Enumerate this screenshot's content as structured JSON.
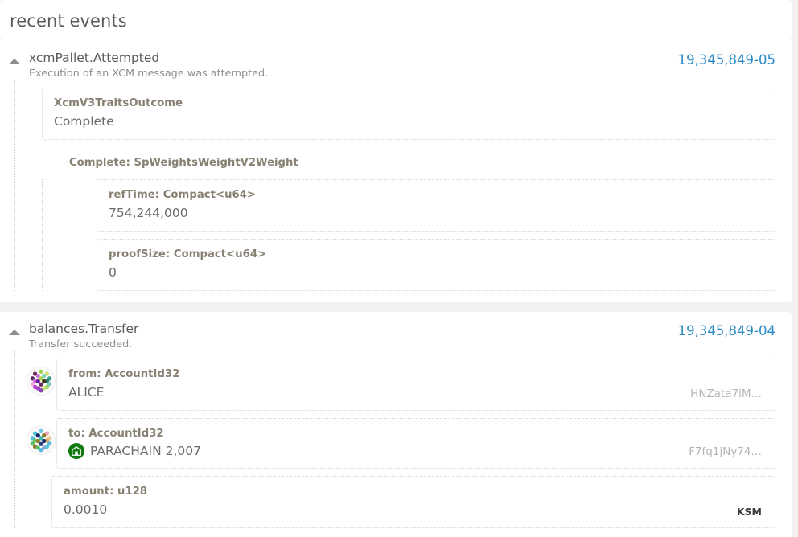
{
  "header": {
    "title": "recent events"
  },
  "events": [
    {
      "name": "xcmPallet.Attempted",
      "description": "Execution of an XCM message was attempted.",
      "block": "19,345,849-05",
      "toggle_icon": "triangle-up-icon",
      "fields": [
        {
          "label": "XcmV3TraitsOutcome",
          "value": "Complete"
        }
      ],
      "subheading": "Complete: SpWeightsWeightV2Weight",
      "subfields": [
        {
          "label": "refTime: Compact<u64>",
          "value": "754,244,000"
        },
        {
          "label": "proofSize: Compact<u64>",
          "value": "0"
        }
      ]
    },
    {
      "name": "balances.Transfer",
      "description": "Transfer succeeded.",
      "block": "19,345,849-04",
      "toggle_icon": "triangle-up-icon",
      "fields": [
        {
          "label": "from: AccountId32",
          "value": "ALICE",
          "address": "HNZata7iM…",
          "identicon": "polkadot-identicon"
        },
        {
          "label": "to: AccountId32",
          "value": "PARACHAIN 2,007",
          "address": "F7fq1jNy74…",
          "identicon": "polkadot-identicon",
          "badge": "parachain-icon"
        },
        {
          "label": "amount: u128",
          "value": "0.0010",
          "unit": "KSM"
        }
      ]
    }
  ],
  "colors": {
    "accent_link": "#2b8ac6",
    "label": "#888173",
    "value": "#6a6a6a",
    "muted": "#b5b5b5",
    "parachain_green": "#107a10",
    "page_bg": "#f2f2f2"
  }
}
